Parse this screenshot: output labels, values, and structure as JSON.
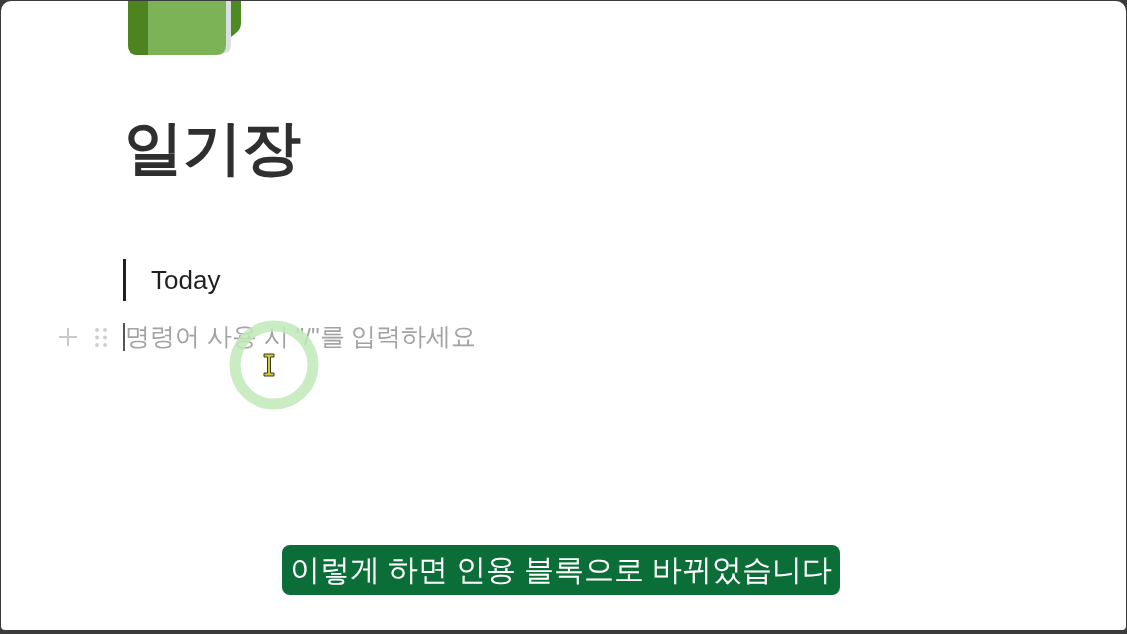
{
  "page": {
    "title": "일기장"
  },
  "blocks": [
    {
      "kind": "quote",
      "text": "Today"
    },
    {
      "kind": "empty",
      "placeholder": "명령어 사용 시 \"/\"를 입력하세요",
      "focused": true
    }
  ],
  "caption": {
    "text": "이렇게 하면 인용 블록으로 바뀌었습니다"
  }
}
